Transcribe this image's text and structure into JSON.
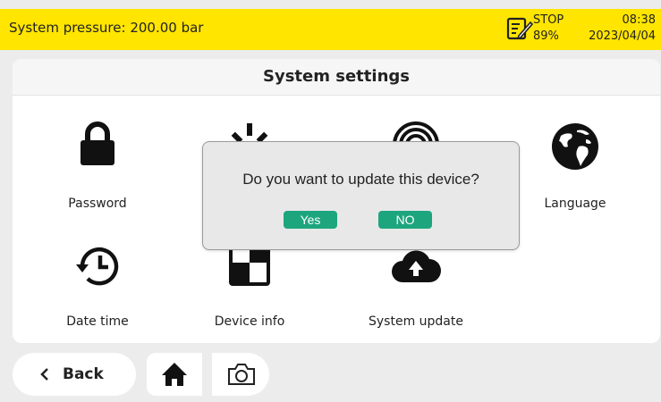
{
  "status": {
    "pressure_text": "System pressure: 200.00 bar",
    "run_state": "STOP",
    "battery": "89%",
    "time": "08:38",
    "date": "2023/04/04",
    "accent_color": "#ffe500"
  },
  "panel": {
    "title": "System settings",
    "tiles": [
      {
        "label": "Password",
        "icon": "lock-icon"
      },
      {
        "label": "",
        "icon": "brightness-icon"
      },
      {
        "label": "",
        "icon": "wifi-icon"
      },
      {
        "label": "Language",
        "icon": "globe-icon"
      },
      {
        "label": "Date time",
        "icon": "history-clock-icon"
      },
      {
        "label": "Device info",
        "icon": "checker-icon"
      },
      {
        "label": "System update",
        "icon": "cloud-upload-icon"
      }
    ]
  },
  "nav": {
    "back_label": "Back",
    "home_icon": "home-icon",
    "camera_icon": "camera-icon"
  },
  "dialog": {
    "message": "Do you want to update this device?",
    "yes_label": "Yes",
    "no_label": "NO",
    "button_color": "#1da57e"
  }
}
